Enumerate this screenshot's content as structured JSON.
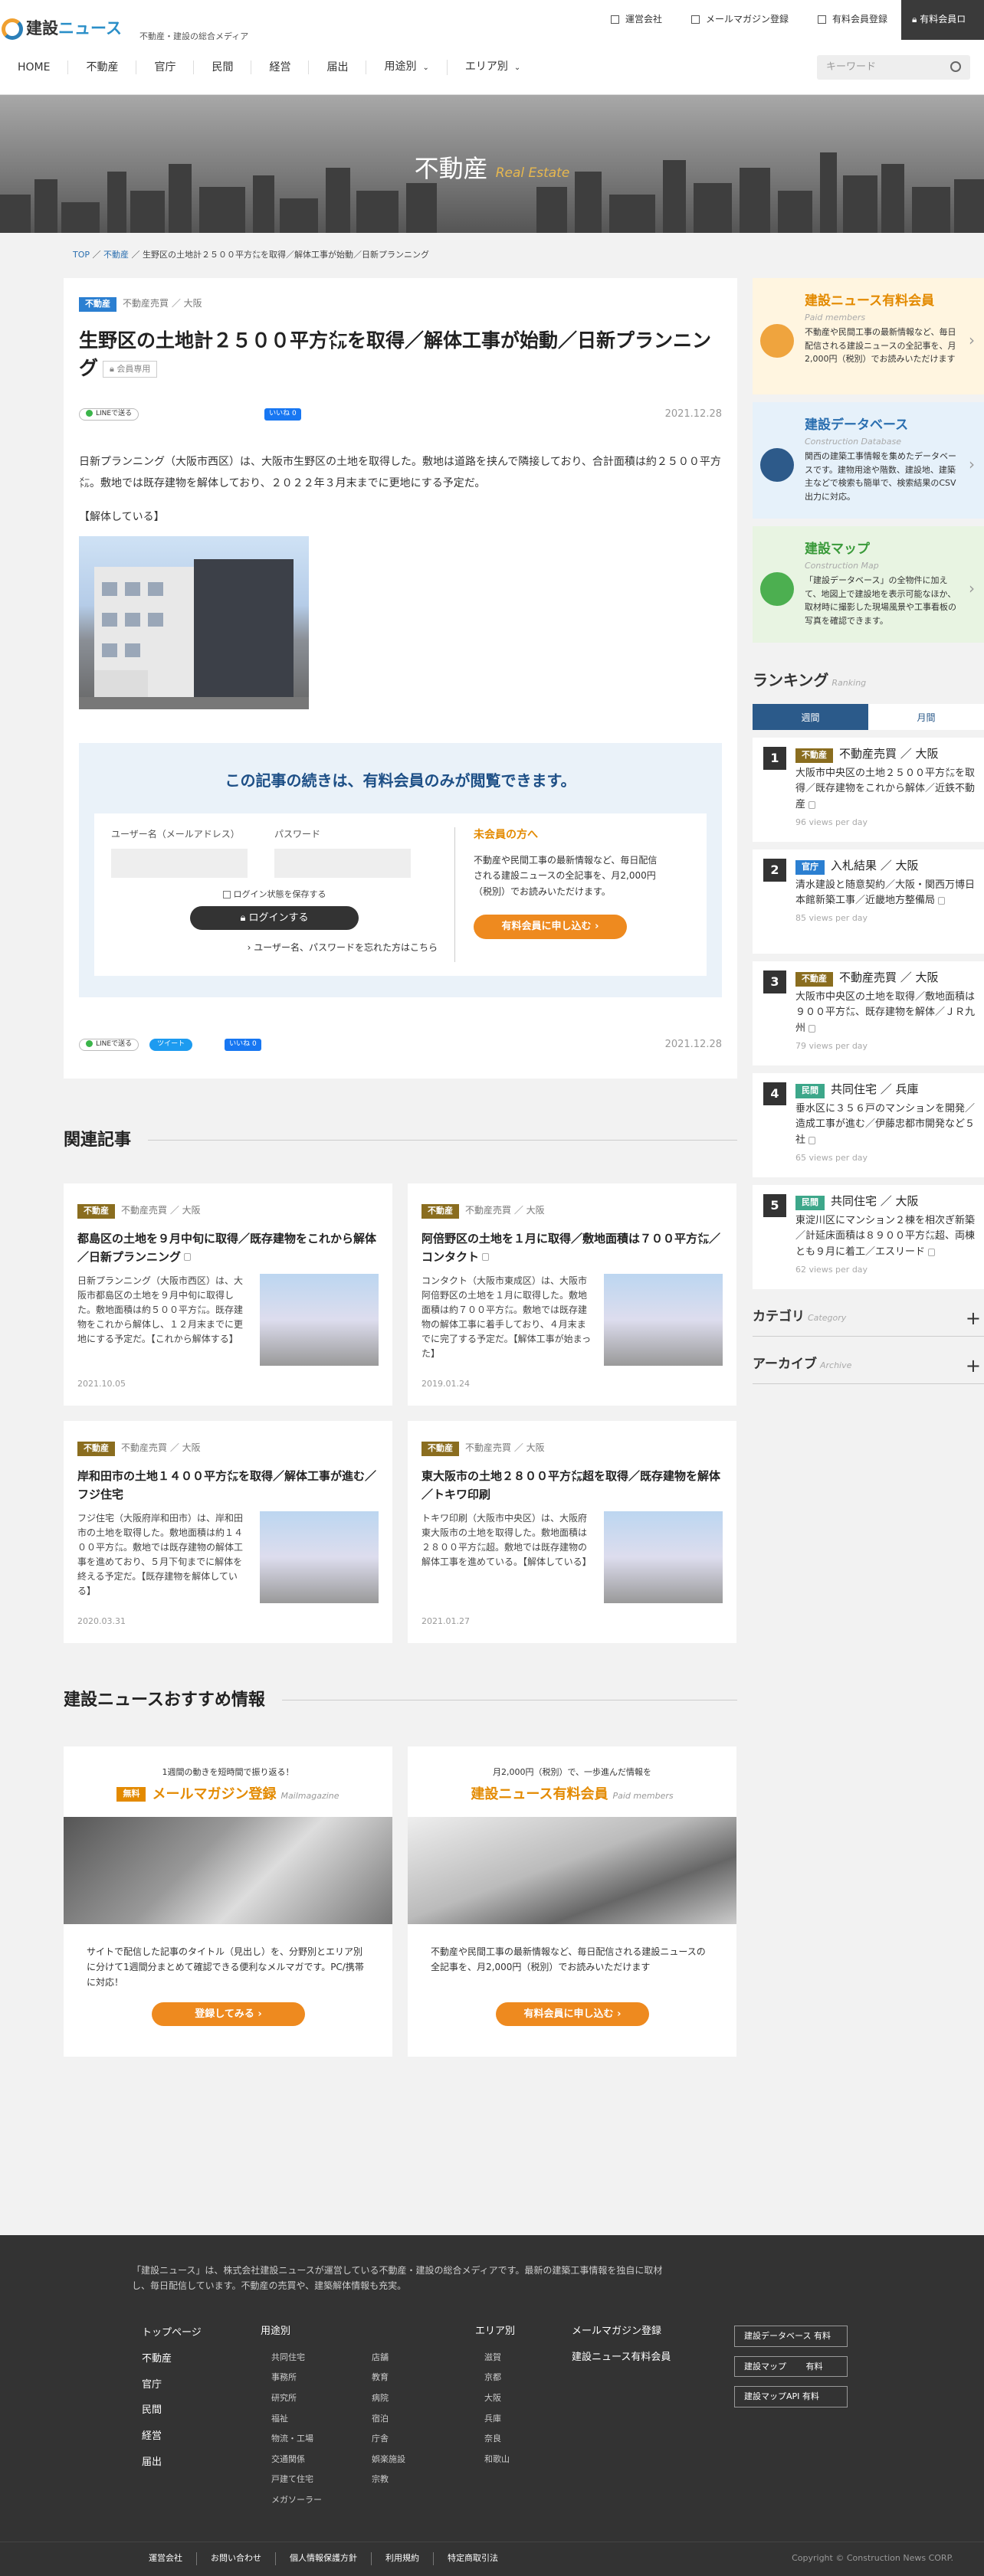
{
  "header": {
    "logo": {
      "part1": "建設",
      "part2": "ニュース"
    },
    "tagline": "不動産・建設の総合メディア",
    "utility": [
      "運営会社",
      "メールマガジン登録",
      "有料会員登録"
    ],
    "paid_member": "有料会員ロ"
  },
  "nav": {
    "items": [
      "HOME",
      "不動産",
      "官庁",
      "民間",
      "経営",
      "届出",
      "用途別",
      "エリア別"
    ],
    "search_placeholder": "キーワード"
  },
  "hero": {
    "title": "不動産",
    "subtitle": "Real Estate"
  },
  "breadcrumb": [
    "TOP",
    "不動産",
    "生野区の土地計２５００平方㍍を取得／解体工事が始動／日新プランニング"
  ],
  "article": {
    "tag": "不動産",
    "category": "不動産売買 ／ 大阪",
    "title": "生野区の土地計２５００平方㍍を取得／解体工事が始動／日新プランニング",
    "member_only": "会員専用",
    "line_label": "LINEで送る",
    "like_label": "いいね 0",
    "tweet_label": "ツイート",
    "date": "2021.12.28",
    "lead": "日新プランニング（大阪市西区）は、大阪市生野区の土地を取得した。敷地は道路を挟んで隣接しており、合計面積は約２５００平方㍍。敷地では既存建物を解体しており、２０２２年３月末までに更地にする予定だ。",
    "caption": "【解体している】"
  },
  "paywall": {
    "title": "この記事の続きは、有料会員のみが閲覧できます。",
    "username_label": "ユーザー名（メールアドレス）",
    "password_label": "パスワード",
    "remember": "ログイン状態を保存する",
    "login": "ログインする",
    "forgot": "ユーザー名、パスワードを忘れた方はこちら",
    "nonmember_title": "未会員の方へ",
    "nonmember_text": "不動産や民間工事の最新情報など、毎日配信される建設ニュースの全記事を、月2,000円（税別）でお読みいただけます。",
    "apply": "有料会員に申し込む"
  },
  "related": {
    "heading": "関連記事",
    "items": [
      {
        "tag": "不動産",
        "category": "不動産売買 ／ 大阪",
        "title": "都島区の土地を９月中旬に取得／既存建物をこれから解体／日新プランニング",
        "text": "日新プランニング（大阪市西区）は、大阪市都島区の土地を９月中旬に取得した。敷地面積は約５００平方㍍。既存建物をこれから解体し、１２月末までに更地にする予定だ。【これから解体する】",
        "date": "2021.10.05"
      },
      {
        "tag": "不動産",
        "category": "不動産売買 ／ 大阪",
        "title": "阿倍野区の土地を１月に取得／敷地面積は７００平方㍍／コンタクト",
        "text": "コンタクト（大阪市東成区）は、大阪市阿倍野区の土地を１月に取得した。敷地面積は約７００平方㍍。敷地では既存建物の解体工事に着手しており、４月末までに完了する予定だ。【解体工事が始まった】",
        "date": "2019.01.24"
      },
      {
        "tag": "不動産",
        "category": "不動産売買 ／ 大阪",
        "title": "岸和田市の土地１４００平方㍍を取得／解体工事が進む／フジ住宅",
        "text": "フジ住宅（大阪府岸和田市）は、岸和田市の土地を取得した。敷地面積は約１４００平方㍍。敷地では既存建物の解体工事を進めており、５月下旬までに解体を終える予定だ。【既存建物を解体している】",
        "date": "2020.03.31"
      },
      {
        "tag": "不動産",
        "category": "不動産売買 ／ 大阪",
        "title": "東大阪市の土地２８００平方㍍超を取得／既存建物を解体／トキワ印刷",
        "text": "トキワ印刷（大阪市中央区）は、大阪府東大阪市の土地を取得した。敷地面積は２８００平方㍍超。敷地では既存建物の解体工事を進めている。【解体している】",
        "date": "2021.01.27"
      }
    ]
  },
  "recommend": {
    "heading": "建設ニュースおすすめ情報",
    "items": [
      {
        "sub": "1週間の動きを短時間で振り返る！",
        "badge": "無料",
        "title": "メールマガジン登録",
        "en": "Mailmagazine",
        "text": "サイトで配信した記事のタイトル（見出し）を、分野別とエリア別に分けて1週間分まとめて確認できる便利なメルマガです。PC/携帯に対応！",
        "button": "登録してみる"
      },
      {
        "sub": "月2,000円（税別）で、一歩進んだ情報を",
        "badge": "",
        "title": "建設ニュース有料会員",
        "en": "Paid members",
        "text": "不動産や民間工事の最新情報など、毎日配信される建設ニュースの全記事を、月2,000円（税別）でお読みいただけます",
        "button": "有料会員に申し込む"
      }
    ]
  },
  "sidebar": {
    "promos": [
      {
        "title": "建設ニュース有料会員",
        "en": "Paid members",
        "text": "不動産や民間工事の最新情報など、毎日配信される建設ニュースの全記事を、月2,000円（税別）でお読みいただけます"
      },
      {
        "title": "建設データベース",
        "en": "Construction Database",
        "text": "関西の建築工事情報を集めたデータベースです。建物用途や階数、建設地、建築主などで検索も簡単で、検索結果のCSV出力に対応。"
      },
      {
        "title": "建設マップ",
        "en": "Construction Map",
        "text": "「建設データベース」の全物件に加えて、地図上で建設地を表示可能なほか、取材時に撮影した現場風景や工事看板の写真を確認できます。"
      }
    ],
    "ranking": {
      "title": "ランキング",
      "en": "Ranking",
      "tabs": [
        "週間",
        "月間"
      ],
      "items": [
        {
          "num": "1",
          "tag": "不動産",
          "category": "不動産売買 ／ 大阪",
          "title": "大阪市中央区の土地２５００平方㍍を取得／既存建物をこれから解体／近鉄不動産",
          "views": "96 views per day"
        },
        {
          "num": "2",
          "tag": "官庁",
          "category": "入札結果 ／ 大阪",
          "title": "清水建設と随意契約／大阪・関西万博日本館新築工事／近畿地方整備局",
          "views": "85 views per day"
        },
        {
          "num": "3",
          "tag": "不動産",
          "category": "不動産売買 ／ 大阪",
          "title": "大阪市中央区の土地を取得／敷地面積は９００平方㍍、既存建物を解体／ＪＲ九州",
          "views": "79 views per day"
        },
        {
          "num": "4",
          "tag": "民間",
          "category": "共同住宅 ／ 兵庫",
          "title": "垂水区に３５６戸のマンションを開発／造成工事が進む／伊藤忠都市開発など５社",
          "views": "65 views per day"
        },
        {
          "num": "5",
          "tag": "民間",
          "category": "共同住宅 ／ 大阪",
          "title": "東淀川区にマンション２棟を相次ぎ新築／計延床面積は８９００平方㍍超、両棟とも９月に着工／エスリード",
          "views": "62 views per day"
        }
      ]
    },
    "category": {
      "title": "カテゴリ",
      "en": "Category"
    },
    "archive": {
      "title": "アーカイブ",
      "en": "Archive"
    }
  },
  "footer": {
    "about": "「建設ニュース」は、株式会社建設ニュースが運営している不動産・建設の総合メディアです。最新の建築工事情報を独自に取材し、毎日配信しています。不動産の売買や、建築解体情報も充実。",
    "col1": [
      "トップページ",
      "不動産",
      "官庁",
      "民間",
      "経営",
      "届出"
    ],
    "col2_head": "用途別",
    "col2a": [
      "共同住宅",
      "事務所",
      "研究所",
      "福祉",
      "物流・工場",
      "交通関係",
      "戸建て住宅",
      "メガソーラー"
    ],
    "col2b": [
      "店舗",
      "教育",
      "病院",
      "宿泊",
      "庁舎",
      "娯楽施設",
      "宗教"
    ],
    "col3_head": "エリア別",
    "col3": [
      "滋賀",
      "京都",
      "大阪",
      "兵庫",
      "奈良",
      "和歌山"
    ],
    "col4": [
      "メールマガジン登録",
      "建設ニュース有料会員"
    ],
    "boxes": [
      "建設データベース 有料",
      "建設マップ　　 有料",
      "建設マップAPI 有料"
    ],
    "bottom_links": [
      "運営会社",
      "お問い合わせ",
      "個人情報保護方針",
      "利用規約",
      "特定商取引法"
    ],
    "copyright": "Copyright © Construction News CORP."
  }
}
